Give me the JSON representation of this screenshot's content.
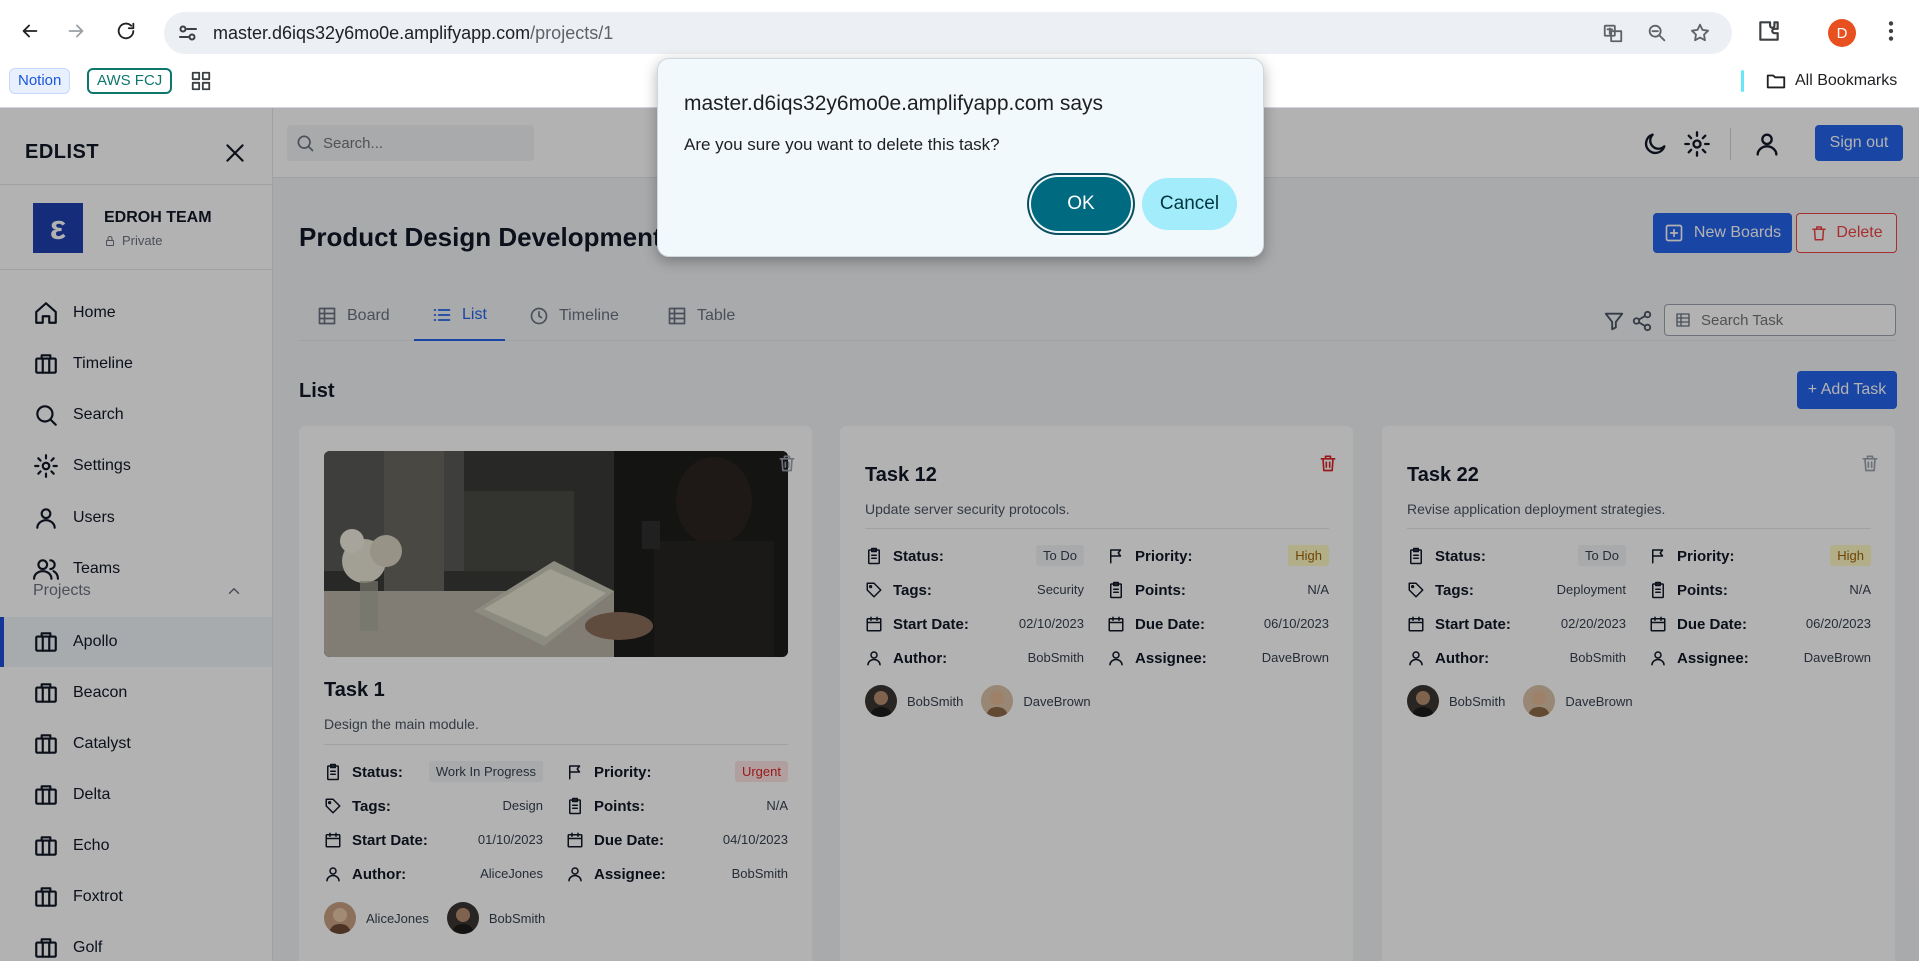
{
  "browser": {
    "url_host": "master.d6iqs32y6mo0e.amplifyapp.com",
    "url_path": "/projects/1",
    "profile_initial": "D",
    "bookmarks": [
      "Notion",
      "AWS FCJ"
    ],
    "all_bookmarks": "All Bookmarks"
  },
  "sidebar": {
    "brand": "EDLIST",
    "team_name": "EDROH TEAM",
    "team_privacy": "Private",
    "team_logo": "ε",
    "nav": [
      {
        "label": "Home",
        "icon": "home-icon"
      },
      {
        "label": "Timeline",
        "icon": "briefcase-icon"
      },
      {
        "label": "Search",
        "icon": "search-icon"
      },
      {
        "label": "Settings",
        "icon": "gear-icon"
      },
      {
        "label": "Users",
        "icon": "user-icon"
      },
      {
        "label": "Teams",
        "icon": "users-icon"
      }
    ],
    "projects_label": "Projects",
    "projects": [
      "Apollo",
      "Beacon",
      "Catalyst",
      "Delta",
      "Echo",
      "Foxtrot",
      "Golf"
    ],
    "active_project": "Apollo"
  },
  "topbar": {
    "search_placeholder": "Search...",
    "signout": "Sign out"
  },
  "main": {
    "title": "Product Design Development",
    "new_boards": "New Boards",
    "delete": "Delete",
    "tabs": [
      "Board",
      "List",
      "Timeline",
      "Table"
    ],
    "active_tab": "List",
    "search_task_placeholder": "Search Task",
    "list_label": "List",
    "add_task": "+ Add Task",
    "labels": {
      "status": "Status:",
      "priority": "Priority:",
      "tags": "Tags:",
      "points": "Points:",
      "start": "Start Date:",
      "due": "Due Date:",
      "author": "Author:",
      "assignee": "Assignee:"
    },
    "cards": [
      {
        "title": "Task 1",
        "description": "Design the main module.",
        "status": "Work In Progress",
        "priority": "Urgent",
        "tags": "Design",
        "points": "N/A",
        "start": "01/10/2023",
        "due": "04/10/2023",
        "author": "AliceJones",
        "assignee": "BobSmith",
        "people": [
          "AliceJones",
          "BobSmith"
        ]
      },
      {
        "title": "Task 12",
        "description": "Update server security protocols.",
        "status": "To Do",
        "priority": "High",
        "tags": "Security",
        "points": "N/A",
        "start": "02/10/2023",
        "due": "06/10/2023",
        "author": "BobSmith",
        "assignee": "DaveBrown",
        "people": [
          "BobSmith",
          "DaveBrown"
        ]
      },
      {
        "title": "Task 22",
        "description": "Revise application deployment strategies.",
        "status": "To Do",
        "priority": "High",
        "tags": "Deployment",
        "points": "N/A",
        "start": "02/20/2023",
        "due": "06/20/2023",
        "author": "BobSmith",
        "assignee": "DaveBrown",
        "people": [
          "BobSmith",
          "DaveBrown"
        ]
      }
    ]
  },
  "dialog": {
    "title": "master.d6iqs32y6mo0e.amplifyapp.com says",
    "message": "Are you sure you want to delete this task?",
    "ok": "OK",
    "cancel": "Cancel"
  },
  "colors": {
    "primary": "#2563eb",
    "danger": "#ef4444",
    "dialog_ok": "#006a80",
    "dialog_cancel": "#a3ecfb"
  }
}
